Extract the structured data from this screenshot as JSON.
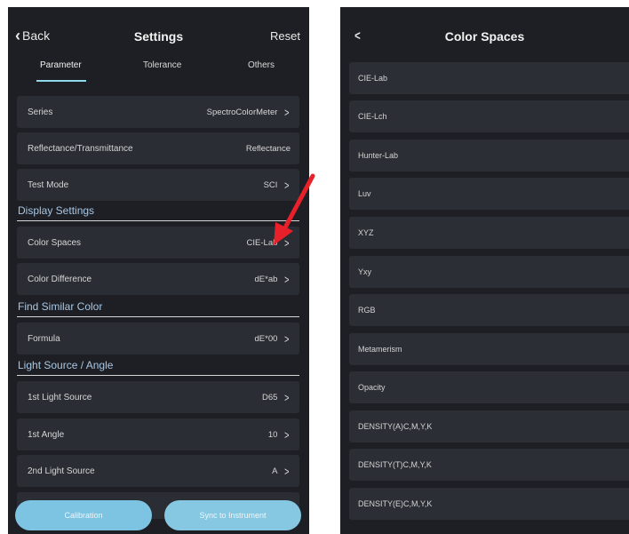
{
  "left": {
    "nav": {
      "back_label": "Back",
      "title": "Settings",
      "reset_label": "Reset"
    },
    "tabs": [
      {
        "label": "Parameter",
        "active": true
      },
      {
        "label": "Tolerance",
        "active": false
      },
      {
        "label": "Others",
        "active": false
      }
    ],
    "rows": [
      {
        "label": "Series",
        "value": "SpectroColorMeter",
        "chevron": true
      },
      {
        "label": "Reflectance/Transmittance",
        "value": "Reflectance",
        "chevron": false
      },
      {
        "label": "Test Mode",
        "value": "SCI",
        "chevron": true
      },
      {
        "label": "Color Spaces",
        "value": "CIE-Lab",
        "chevron": true
      },
      {
        "label": "Color Difference",
        "value": "dE*ab",
        "chevron": true
      },
      {
        "label": "Formula",
        "value": "dE*00",
        "chevron": true
      },
      {
        "label": "1st Light Source",
        "value": "D65",
        "chevron": true
      },
      {
        "label": "1st Angle",
        "value": "10",
        "chevron": true
      },
      {
        "label": "2nd Light Source",
        "value": "A",
        "chevron": true
      }
    ],
    "sections": {
      "display": "Display Settings",
      "similar": "Find Similar Color",
      "light": "Light Source / Angle"
    },
    "buttons": {
      "calibration": "Calibration",
      "sync": "Sync to Instrument"
    },
    "accent_color": "#8fd7ea",
    "annotation_color": "#e8202a"
  },
  "right": {
    "title": "Color Spaces",
    "items": [
      "CIE-Lab",
      "CIE-Lch",
      "Hunter-Lab",
      "Luv",
      "XYZ",
      "Yxy",
      "RGB",
      "Metamerism",
      "Opacity",
      "DENSITY(A)C,M,Y,K",
      "DENSITY(T)C,M,Y,K",
      "DENSITY(E)C,M,Y,K"
    ]
  }
}
